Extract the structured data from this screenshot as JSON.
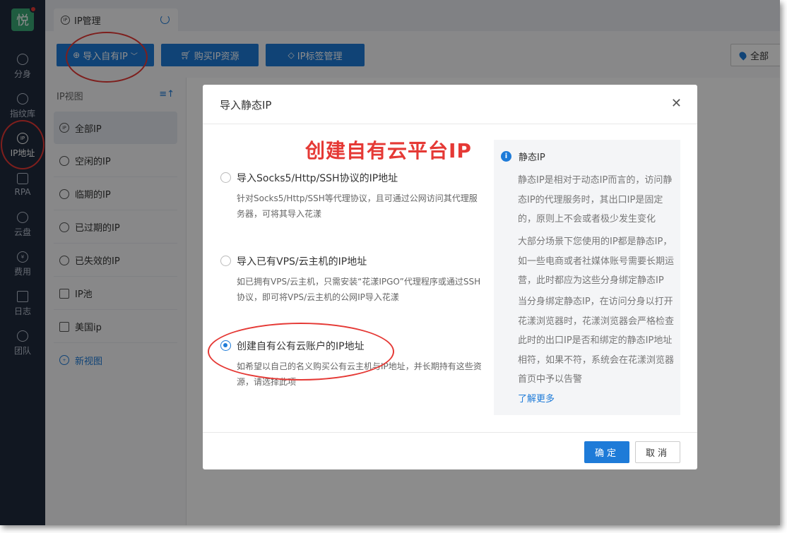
{
  "app": {
    "logo_text": "悦"
  },
  "nav": [
    {
      "label": "分身",
      "icon": "chrome-icon"
    },
    {
      "label": "指纹库",
      "icon": "fingerprint-icon"
    },
    {
      "label": "IP地址",
      "icon": "ip-icon",
      "active": true
    },
    {
      "label": "RPA",
      "icon": "robot-icon"
    },
    {
      "label": "云盘",
      "icon": "cloud-drive-icon"
    },
    {
      "label": "费用",
      "icon": "yen-icon"
    },
    {
      "label": "日志",
      "icon": "log-icon"
    },
    {
      "label": "团队",
      "icon": "team-icon"
    }
  ],
  "tab": {
    "label": "IP管理",
    "icon_text": "IP"
  },
  "toolbar": {
    "import_label": "导入自有IP",
    "buy_label": "购买IP资源",
    "tag_label": "IP标签管理",
    "all_label": "全部"
  },
  "views": {
    "title": "IP视图",
    "items": [
      {
        "label": "全部IP",
        "active": true
      },
      {
        "label": "空闲的IP"
      },
      {
        "label": "临期的IP"
      },
      {
        "label": "已过期的IP"
      },
      {
        "label": "已失效的IP"
      },
      {
        "label": "IP池"
      },
      {
        "label": "美国ip"
      }
    ],
    "new_label": "新视图"
  },
  "dialog": {
    "title": "导入静态IP",
    "annotation": "创建自有云平台IP",
    "options": [
      {
        "label": "导入Socks5/Http/SSH协议的IP地址",
        "desc": "针对Socks5/Http/SSH等代理协议，且可通过公网访问其代理服务器，可将其导入花漾"
      },
      {
        "label": "导入已有VPS/云主机的IP地址",
        "desc": "如已拥有VPS/云主机，只需安装“花漾IPGO”代理程序或通过SSH协议，即可将VPS/云主机的公网IP导入花漾"
      },
      {
        "label": "创建自有公有云账户的IP地址",
        "desc": "如希望以自己的名义购买公有云主机与IP地址，并长期持有这些资源，请选择此项"
      }
    ],
    "info": {
      "title": "静态IP",
      "paragraphs": [
        "静态IP是相对于动态IP而言的，访问静态IP的代理服务时，其出口IP是固定的，原则上不会或者极少发生变化",
        "大部分场景下您使用的IP都是静态IP，如一些电商或者社媒体账号需要长期运营，此时都应为这些分身绑定静态IP",
        "当分身绑定静态IP，在访问分身以打开花漾浏览器时，花漾浏览器会严格检查此时的出口IP是否和绑定的静态IP地址相符，如果不符，系统会在花漾浏览器首页中予以告警"
      ],
      "link": "了解更多"
    },
    "ok_label": "确定",
    "cancel_label": "取消"
  }
}
